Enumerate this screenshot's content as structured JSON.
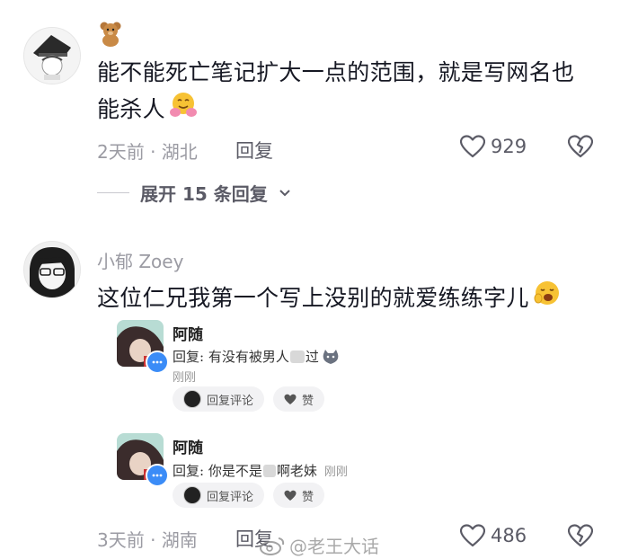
{
  "comment1": {
    "sticker_icon": "teddy-bear-sticker",
    "text": "能不能死亡笔记扩大一点的范围，就是写网名也能杀人",
    "text_line1": "能不能死亡笔记扩大一点的范围，就是写网名也",
    "text_line2": "能杀人",
    "emoji_icon": "hugging-face-emoji",
    "time_location": "2天前 · 湖北",
    "reply_label": "回复",
    "likes": "929",
    "expand_label": "展开 15 条回复"
  },
  "comment2": {
    "username": "小郁 Zoey",
    "text": "这位仁兄我第一个写上没别的就爱练练字儿",
    "emoji_icon": "yawning-face-emoji",
    "time_location": "3天前 · 湖南",
    "reply_label": "回复",
    "likes": "486",
    "embedded_replies": [
      {
        "name": "阿随",
        "text": "回复: 有没有被男人",
        "text_tail": "过",
        "time": "刚刚",
        "reply_comment_label": "回复评论",
        "like_label": "赞"
      },
      {
        "name": "阿随",
        "text": "回复: 你是不是",
        "text_tail": "啊老妹",
        "time": "刚刚",
        "reply_comment_label": "回复评论",
        "like_label": "赞"
      }
    ]
  },
  "watermark": "@老王大话"
}
